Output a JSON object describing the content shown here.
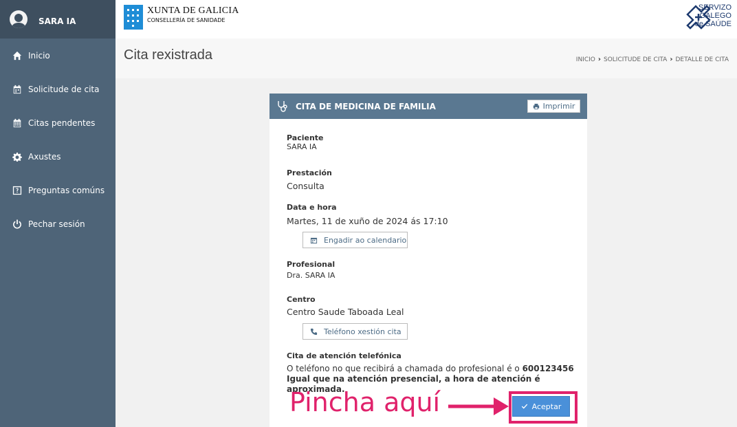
{
  "sidebar": {
    "user_name": "SARA IA",
    "items": [
      {
        "label": "Inicio",
        "icon": "home-icon"
      },
      {
        "label": "Solicitude de cita",
        "icon": "calendar-plus-icon"
      },
      {
        "label": "Citas pendentes",
        "icon": "calendar-icon"
      },
      {
        "label": "Axustes",
        "icon": "gear-icon"
      },
      {
        "label": "Preguntas comúns",
        "icon": "question-icon"
      },
      {
        "label": "Pechar sesión",
        "icon": "power-icon"
      }
    ]
  },
  "header": {
    "xunta_title": "XUNTA DE GALICIA",
    "xunta_sub": "CONSELLERÍA DE SANIDADE",
    "sgs_line1": "SERVIZO",
    "sgs_line2": "GALEGO",
    "sgs_line3": "de SAÚDE"
  },
  "page": {
    "title": "Cita rexistrada",
    "breadcrumb": [
      "INICIO",
      "SOLICITUDE DE CITA",
      "DETALLE DE CITA"
    ]
  },
  "card": {
    "title": "CITA DE MEDICINA DE FAMILIA",
    "print_label": "Imprimir",
    "paciente_label": "Paciente",
    "paciente_value": "SARA IA",
    "prestacion_label": "Prestación",
    "prestacion_value": "Consulta",
    "data_label": "Data e hora",
    "data_value": "Martes, 11 de xuño de 2024 ás 17:10",
    "calendar_button": "Engadir ao calendario",
    "profesional_label": "Profesional",
    "profesional_value": "Dra. SARA IA",
    "centro_label": "Centro",
    "centro_value": "Centro Saude Taboada Leal",
    "telefono_button": "Teléfono xestión cita",
    "tel_label": "Cita de atención telefónica",
    "tel_text": "O teléfono no que recibirá a chamada do profesional é o ",
    "tel_number": "600123456",
    "tel_note": "Igual que na atención presencial, a hora de atención é aproximada.",
    "accept_label": "Aceptar"
  },
  "annotation": {
    "text": "Pincha aquí",
    "color": "#e0226b"
  }
}
